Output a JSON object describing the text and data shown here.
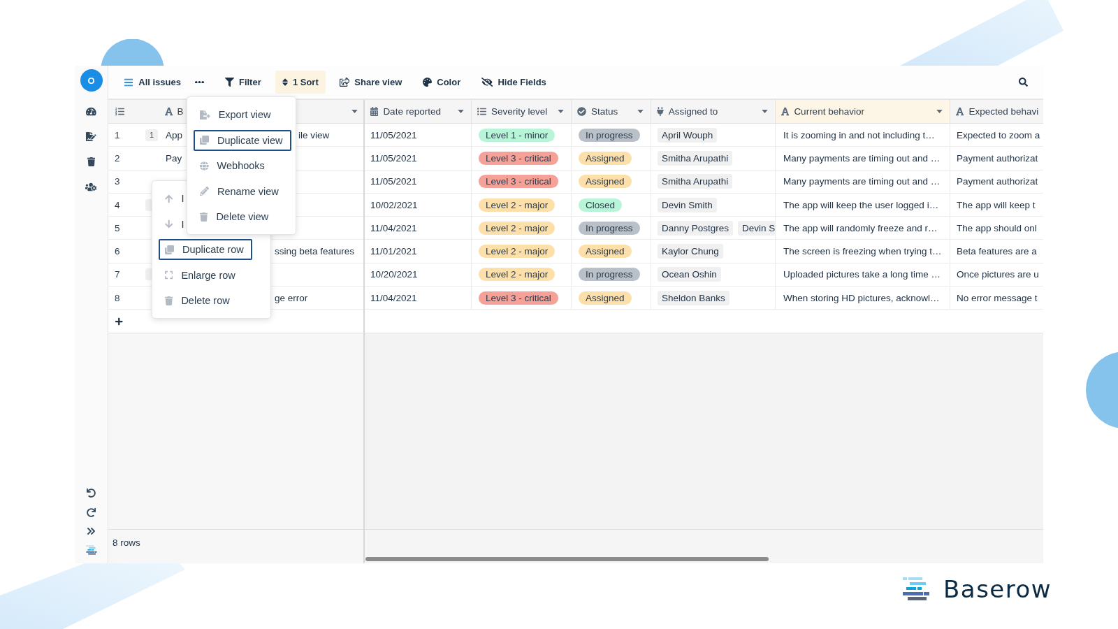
{
  "sidebar": {
    "avatar": "O"
  },
  "toolbar": {
    "view": "All issues",
    "buttons": [
      {
        "label": "Filter",
        "active": false
      },
      {
        "label": "1 Sort",
        "active": true
      },
      {
        "label": "Share view",
        "active": false
      },
      {
        "label": "Color",
        "active": false
      },
      {
        "label": "Hide Fields",
        "active": false
      }
    ]
  },
  "view_menu": {
    "items": [
      {
        "label": "Export view",
        "highlighted": false
      },
      {
        "label": "Duplicate view",
        "highlighted": true
      },
      {
        "label": "Webhooks",
        "highlighted": false
      },
      {
        "label": "Rename view",
        "highlighted": false
      },
      {
        "label": "Delete view",
        "highlighted": false
      }
    ]
  },
  "row_menu": {
    "items": [
      {
        "label": "I",
        "highlighted": false
      },
      {
        "label": "I",
        "highlighted": false
      },
      {
        "label": "Duplicate row",
        "highlighted": true
      },
      {
        "label": "Enlarge row",
        "highlighted": false
      },
      {
        "label": "Delete row",
        "highlighted": false
      }
    ]
  },
  "table": {
    "primary_column": {
      "name": "B"
    },
    "columns": [
      {
        "name": "Date reported",
        "kind": "date",
        "sorted": false
      },
      {
        "name": "Severity level",
        "kind": "select",
        "sorted": false
      },
      {
        "name": "Status",
        "kind": "status",
        "sorted": false
      },
      {
        "name": "Assigned to",
        "kind": "link",
        "sorted": false
      },
      {
        "name": "Current behavior",
        "kind": "text",
        "sorted": true
      },
      {
        "name": "Expected behavi",
        "kind": "text",
        "sorted": false
      }
    ],
    "rows": [
      {
        "number": "1",
        "link_badge": true,
        "count": "1",
        "name_start": "App",
        "name_end": "ile view",
        "cells": [
          {
            "text": "11/05/2021"
          },
          {
            "text": "Level 1 - minor",
            "color": "#b8f4d7"
          },
          {
            "text": "In progress",
            "color": "#bac0c8"
          },
          {
            "chips": [
              "April Wouph"
            ]
          },
          {
            "text": "It is zooming in and not including t…"
          },
          {
            "text": "Expected to zoom a"
          }
        ]
      },
      {
        "number": "2",
        "link_badge": false,
        "name_start": "Pay",
        "cells": [
          {
            "text": "11/05/2021"
          },
          {
            "text": "Level 3 - critical",
            "color": "#f5a197"
          },
          {
            "text": "Assigned",
            "color": "#fde0a9"
          },
          {
            "chips": [
              "Smitha Arupathi"
            ]
          },
          {
            "text": "Many payments are timing out and …"
          },
          {
            "text": "Payment authorizat"
          }
        ]
      },
      {
        "number": "3",
        "link_badge": false,
        "cells": [
          {
            "text": "11/05/2021"
          },
          {
            "text": "Level 3 - critical",
            "color": "#f5a197"
          },
          {
            "text": "Assigned",
            "color": "#fde0a9"
          },
          {
            "chips": [
              "Smitha Arupathi"
            ]
          },
          {
            "text": "Many payments are timing out and …"
          },
          {
            "text": "Payment authorizat"
          }
        ]
      },
      {
        "number": "4",
        "link_badge": true,
        "cells": [
          {
            "text": "10/02/2021"
          },
          {
            "text": "Level 2 - major",
            "color": "#fde0a9"
          },
          {
            "text": "Closed",
            "color": "#b8f4d7"
          },
          {
            "chips": [
              "Devin Smith"
            ]
          },
          {
            "text": "The app will keep the user logged i…"
          },
          {
            "text": "The app will keep t"
          }
        ]
      },
      {
        "number": "5",
        "link_badge": false,
        "cells": [
          {
            "text": "11/04/2021"
          },
          {
            "text": "Level 2 - major",
            "color": "#fde0a9"
          },
          {
            "text": "In progress",
            "color": "#bac0c8"
          },
          {
            "chips": [
              "Danny Postgres",
              "Devin S"
            ]
          },
          {
            "text": "The app will randomly freeze and r…"
          },
          {
            "text": "The app should onl"
          }
        ]
      },
      {
        "number": "6",
        "link_badge": false,
        "name_end": "ssing beta features",
        "cells": [
          {
            "text": "11/01/2021"
          },
          {
            "text": "Level 2 - major",
            "color": "#fde0a9"
          },
          {
            "text": "Assigned",
            "color": "#fde0a9"
          },
          {
            "chips": [
              "Kaylor Chung"
            ]
          },
          {
            "text": "The screen is freezing when trying t…"
          },
          {
            "text": "Beta features are a"
          }
        ]
      },
      {
        "number": "7",
        "link_badge": true,
        "cells": [
          {
            "text": "10/20/2021"
          },
          {
            "text": "Level 2 - major",
            "color": "#fde0a9"
          },
          {
            "text": "In progress",
            "color": "#bac0c8"
          },
          {
            "chips": [
              "Ocean Oshin"
            ]
          },
          {
            "text": "Uploaded pictures take a long time …"
          },
          {
            "text": "Once pictures are u"
          }
        ]
      },
      {
        "number": "8",
        "link_badge": false,
        "name_end": "ge error",
        "cells": [
          {
            "text": "11/04/2021"
          },
          {
            "text": "Level 3 - critical",
            "color": "#f5a197"
          },
          {
            "text": "Assigned",
            "color": "#fde0a9"
          },
          {
            "chips": [
              "Sheldon Banks"
            ]
          },
          {
            "text": "When storing HD pictures, acknowl…"
          },
          {
            "text": "No error message t"
          }
        ]
      }
    ]
  },
  "status_bar": {
    "row_count": "8 rows"
  },
  "logo": {
    "name": "Baserow"
  }
}
